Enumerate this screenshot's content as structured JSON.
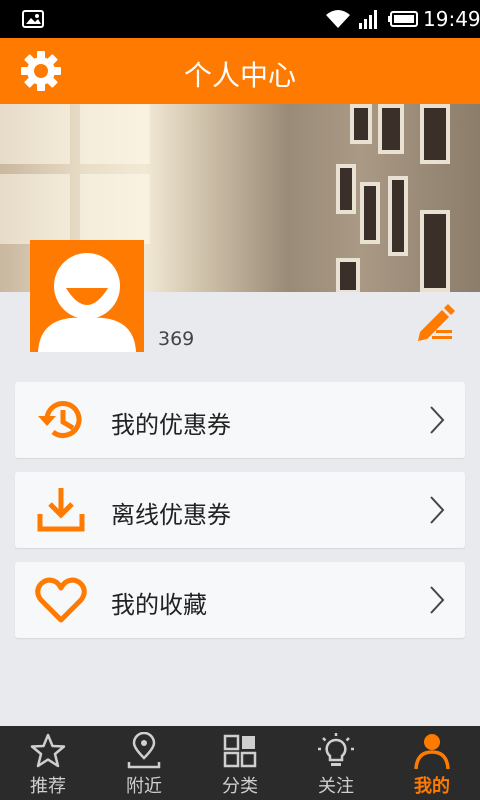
{
  "status_bar": {
    "time": "19:49"
  },
  "header": {
    "title": "个人中心",
    "settings_icon": "gear-icon"
  },
  "profile": {
    "username": "369",
    "avatar_icon": "avatar-icon",
    "edit_icon": "edit-icon"
  },
  "menu": [
    {
      "label": "我的优惠券",
      "icon": "history-icon"
    },
    {
      "label": "离线优惠券",
      "icon": "download-icon"
    },
    {
      "label": "我的收藏",
      "icon": "heart-icon"
    }
  ],
  "tabs": [
    {
      "label": "推荐",
      "icon": "star-icon"
    },
    {
      "label": "附近",
      "icon": "location-icon"
    },
    {
      "label": "分类",
      "icon": "grid-icon"
    },
    {
      "label": "关注",
      "icon": "lightbulb-icon"
    },
    {
      "label": "我的",
      "icon": "person-icon",
      "active": true
    }
  ],
  "colors": {
    "accent": "#ff7a00",
    "tabbar_bg": "#2b2b2b",
    "page_bg": "#e8eaed"
  }
}
